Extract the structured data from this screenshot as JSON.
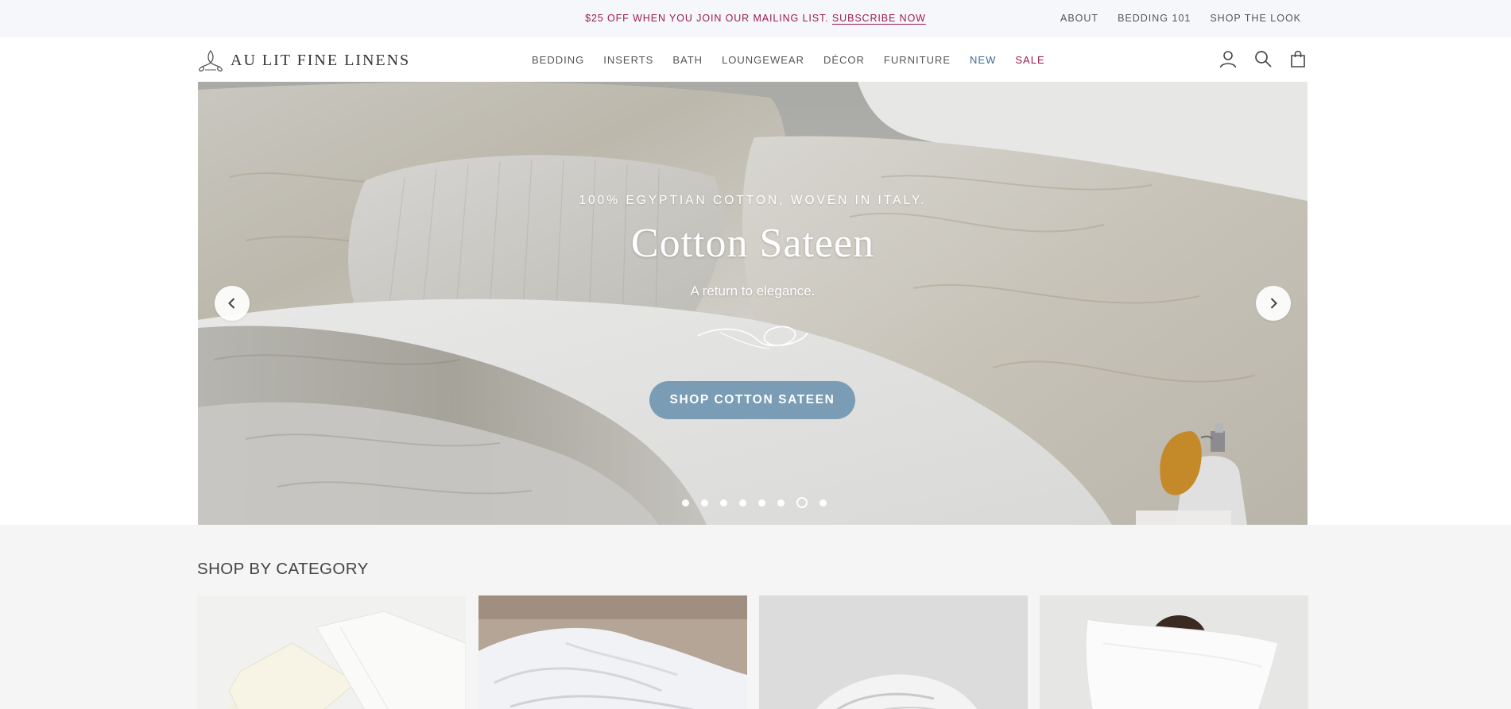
{
  "announcement": {
    "text": "$25 OFF WHEN YOU JOIN OUR MAILING LIST.",
    "link": "SUBSCRIBE NOW",
    "color": "#9b1b4f"
  },
  "utility_nav": [
    "ABOUT",
    "BEDDING 101",
    "SHOP THE LOOK"
  ],
  "brand": {
    "name": "AU LIT FINE LINENS",
    "logo_icon": "flourish-logo-icon"
  },
  "main_nav": [
    {
      "label": "BEDDING"
    },
    {
      "label": "INSERTS"
    },
    {
      "label": "BATH"
    },
    {
      "label": "LOUNGEWEAR"
    },
    {
      "label": "DÉCOR"
    },
    {
      "label": "FURNITURE"
    },
    {
      "label": "NEW",
      "color": "#3d6a93"
    },
    {
      "label": "SALE",
      "color": "#9b1b4f"
    }
  ],
  "header_icons": [
    "account-icon",
    "search-icon",
    "cart-icon"
  ],
  "hero": {
    "eyebrow": "100% EGYPTIAN COTTON, WOVEN IN ITALY.",
    "title": "Cotton Sateen",
    "subtitle": "A return to elegance.",
    "cta": "SHOP COTTON SATEEN",
    "cta_color": "#7a9db5",
    "slide_count": 8,
    "active_slide": 7
  },
  "category_section": {
    "heading": "SHOP BY CATEGORY",
    "tiles": [
      "sheets-category-image",
      "duvet-category-image",
      "comforter-category-image",
      "pillow-category-image"
    ]
  }
}
